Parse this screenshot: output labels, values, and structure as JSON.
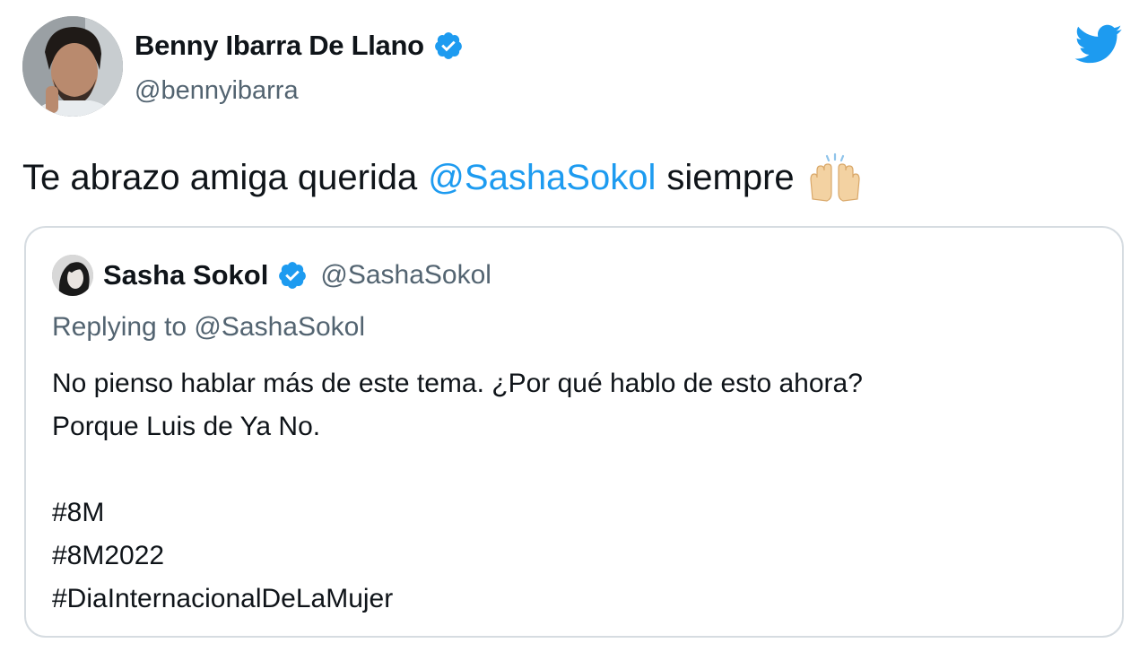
{
  "author": {
    "name": "Benny Ibarra De Llano",
    "handle": "@bennyibarra",
    "verified": true
  },
  "tweet": {
    "text_before": "Te abrazo amiga querida",
    "mention": "@SashaSokol",
    "text_after": "siempre",
    "emoji": "raising-hands-emoji"
  },
  "quoted_tweet": {
    "name": "Sasha Sokol",
    "handle": "@SashaSokol",
    "verified": true,
    "replying_to": "Replying to @SashaSokol",
    "lines": [
      "No pienso hablar más de este tema. ¿Por qué hablo de esto ahora?",
      "Porque Luis de Ya No."
    ],
    "hashtags": [
      "#8M",
      "#8M2022",
      "#DiaInternacionalDeLaMujer"
    ]
  },
  "icons": {
    "logo": "twitter-bird-icon",
    "verified": "verified-badge-icon"
  },
  "colors": {
    "brand_blue": "#1d9bf0",
    "text_primary": "#0f1419",
    "text_secondary": "#536471",
    "border": "#d6dce1"
  }
}
